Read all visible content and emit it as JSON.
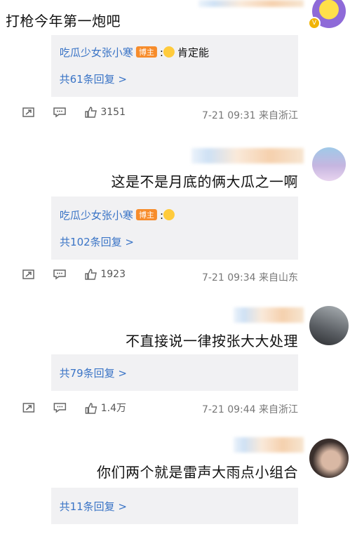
{
  "comments": [
    {
      "text": "打枪今年第一炮吧",
      "reply_author": "吃瓜少女张小寒",
      "reply_tag": "博主",
      "reply_text": "肯定能",
      "reply_count": "共61条回复 >",
      "time": "7-21 09:31",
      "location": "来自浙江",
      "likes": "3151"
    },
    {
      "text": "这是不是月底的俩大瓜之一啊",
      "reply_author": "吃瓜少女张小寒",
      "reply_tag": "博主",
      "reply_text": "",
      "reply_count": "共102条回复 >",
      "time": "7-21 09:34",
      "location": "来自山东",
      "likes": "1923"
    },
    {
      "text": "不直接说一律按张大大处理",
      "reply_count": "共79条回复 >",
      "time": "7-21 09:44",
      "location": "来自浙江",
      "likes": "1.4万"
    },
    {
      "text": "你们两个就是雷声大雨点小组合",
      "reply_count": "共11条回复 >"
    }
  ],
  "icons": {
    "share": "share-icon",
    "comment": "comment-icon",
    "like": "like-icon",
    "verified": "verified-badge-icon"
  }
}
